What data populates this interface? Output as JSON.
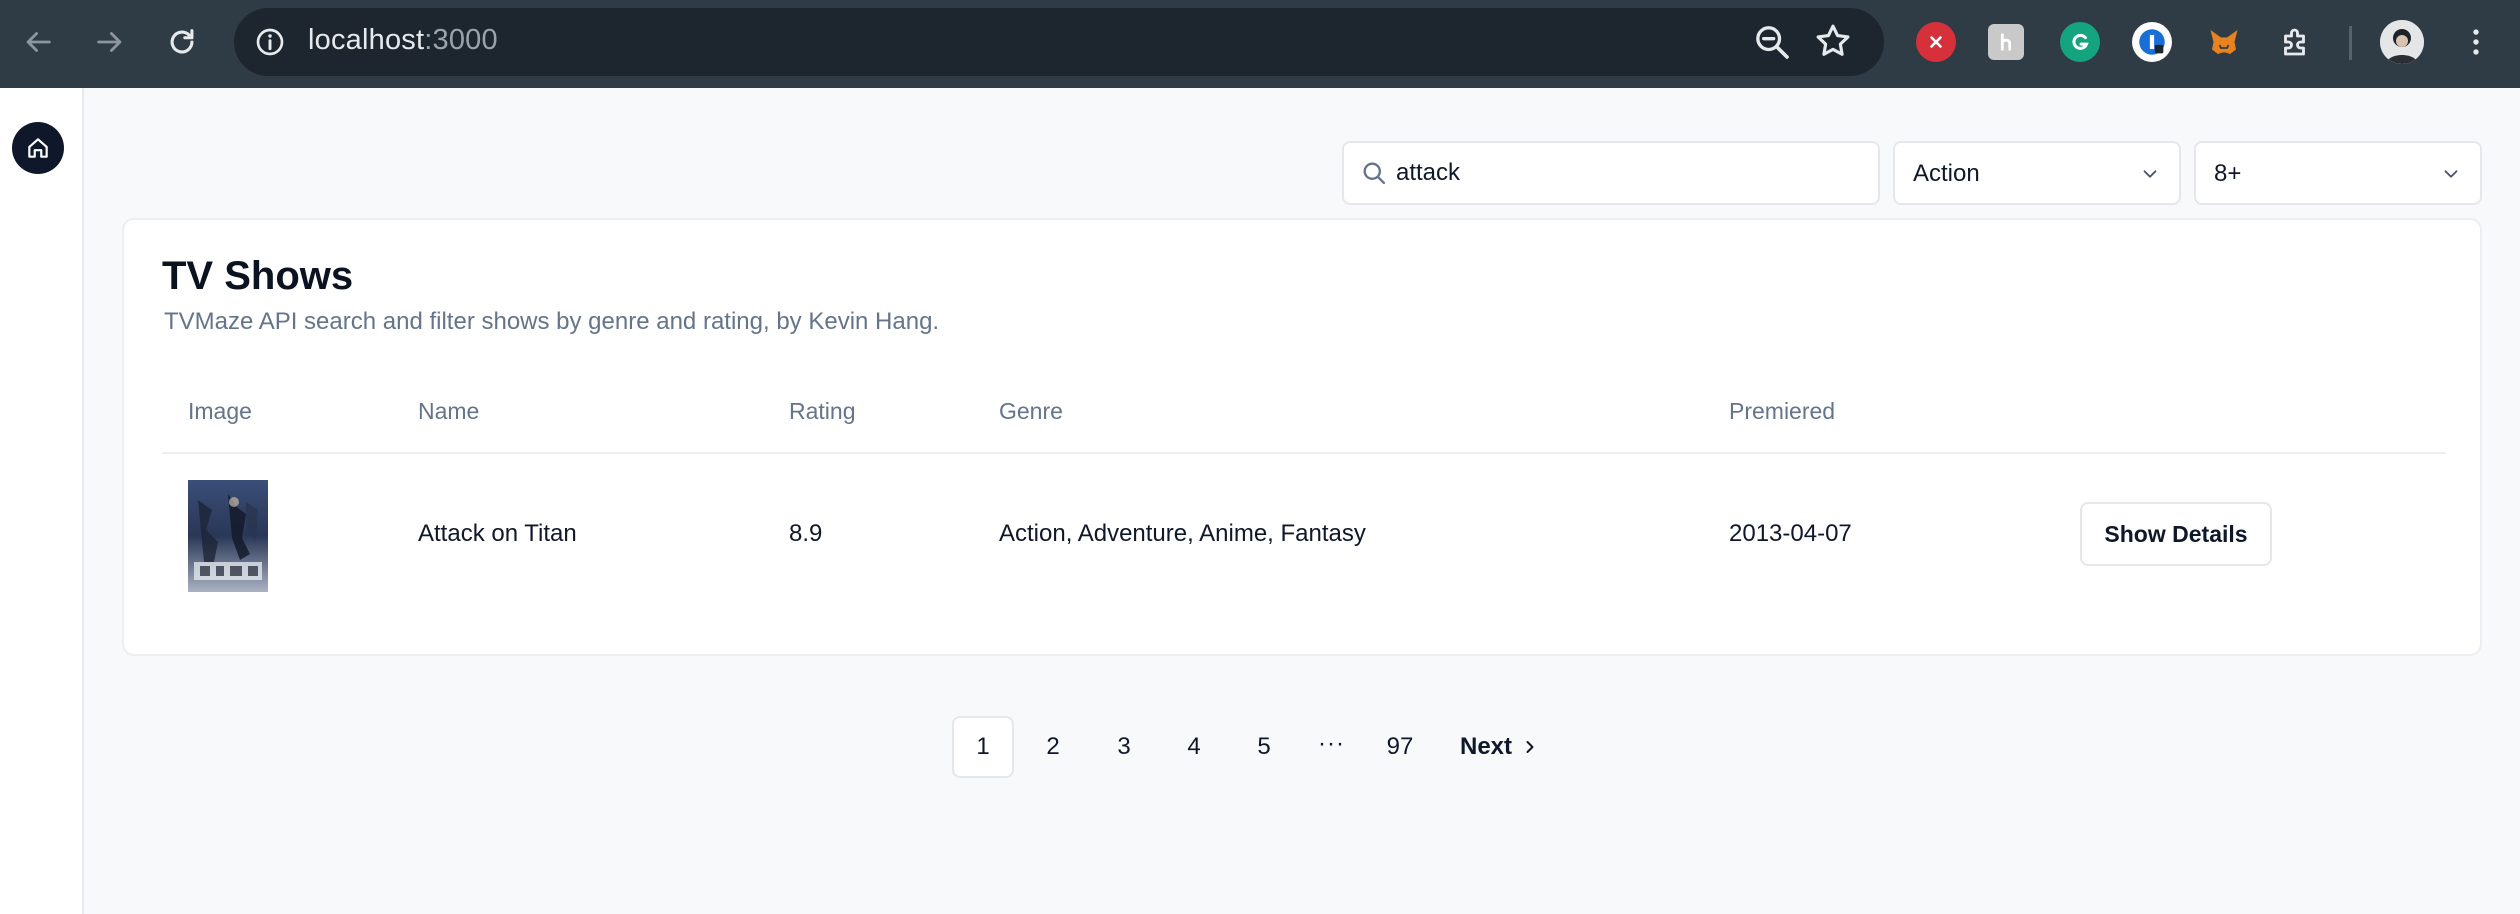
{
  "browser": {
    "url_host": "localhost",
    "url_port": ":3000",
    "extensions": [
      "close-extension-icon",
      "hack-extension-icon",
      "grammarly-icon",
      "password-manager-icon",
      "metamask-icon",
      "puzzle-icon"
    ]
  },
  "filters": {
    "search_value": "attack",
    "genre": "Action",
    "rating": "8+"
  },
  "card": {
    "title": "TV Shows",
    "subtitle": "TVMaze API search and filter shows by genre and rating, by Kevin Hang."
  },
  "table": {
    "headers": [
      "Image",
      "Name",
      "Rating",
      "Genre",
      "Premiered"
    ],
    "rows": [
      {
        "name": "Attack on Titan",
        "rating": "8.9",
        "genre": "Action, Adventure, Anime, Fantasy",
        "premiered": "2013-04-07",
        "action": "Show Details"
      }
    ]
  },
  "pagination": {
    "pages": [
      "1",
      "2",
      "3",
      "4",
      "5"
    ],
    "ellipsis": "···",
    "last": "97",
    "next": "Next",
    "current": "1"
  }
}
